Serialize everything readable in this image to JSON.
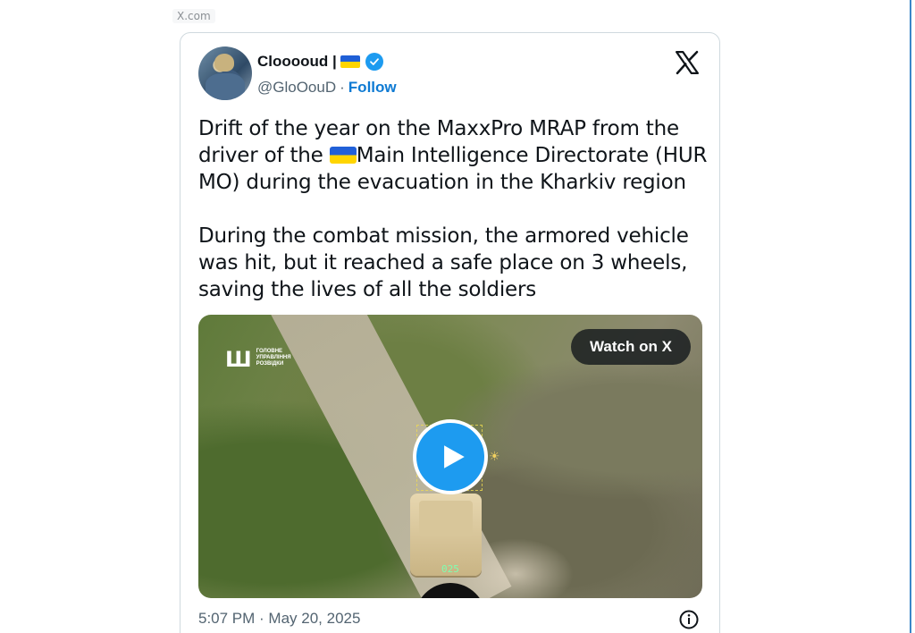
{
  "source": {
    "label": "X.com"
  },
  "tweet": {
    "author_name": "Clooooud |",
    "handle": "@GloOouD",
    "separator": "·",
    "follow_label": "Follow",
    "paragraph1_part1": "Drift of the year on the MaxxPro MRAP from the driver of the ",
    "paragraph1_part2": "Main Intelligence Directorate (HUR MO) during the evacuation in the Kharkiv region",
    "paragraph2": "During the combat mission, the armored vehicle was hit, but it reached a safe place on 3 wheels, saving the lives of all the soldiers",
    "timestamp": "5:07 PM · May 20, 2025"
  },
  "media": {
    "watch_label": "Watch on X",
    "watermark_text": "ГОЛОВНЕ УПРАВЛІННЯ РОЗВІДКИ",
    "watermark_symbol": "Ш",
    "hud_number": "025",
    "hud_sun": "☀"
  },
  "icons": {
    "verified": "verified-badge-icon",
    "x_logo": "x-logo-icon",
    "play": "play-icon",
    "info": "info-icon"
  },
  "colors": {
    "accent_blue": "#1d9bf0",
    "follow_blue": "#0e7ad3",
    "text_primary": "#0f1419",
    "text_secondary": "#536471",
    "flag_blue": "#1f5fd6",
    "flag_yellow": "#ffd500"
  }
}
